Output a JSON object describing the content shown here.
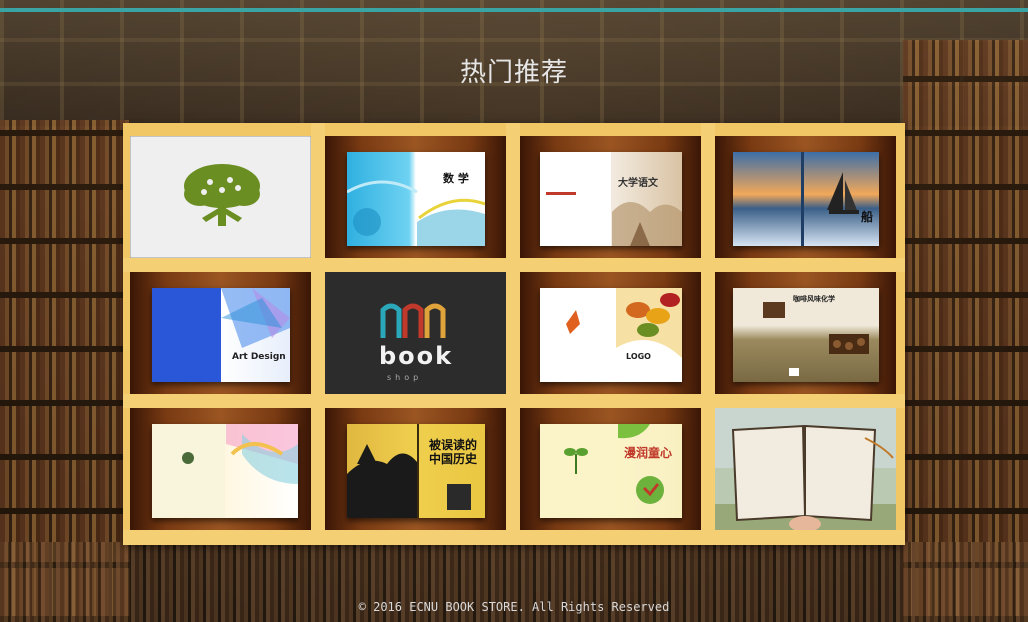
{
  "header": {
    "title": "热门推荐"
  },
  "footer": {
    "copyright": "© 2016 ECNU BOOK STORE. All Rights Reserved"
  },
  "books": [
    {
      "name": "book-tree-logo",
      "cover_text": ""
    },
    {
      "name": "book-math",
      "cover_text": "数 学"
    },
    {
      "name": "book-college-chinese",
      "cover_text": "大学语文"
    },
    {
      "name": "book-sea-boat",
      "cover_text": "船"
    },
    {
      "name": "book-logo-art-design",
      "cover_text": "Art Design"
    },
    {
      "name": "book-book-shop-logo",
      "cover_text": "book"
    },
    {
      "name": "book-autumn-leaves",
      "cover_text": "LOGO"
    },
    {
      "name": "book-coffee-culture",
      "cover_text": "咖啡风味化学"
    },
    {
      "name": "book-pastel-cover",
      "cover_text": ""
    },
    {
      "name": "book-misread-history",
      "cover_text": "被误读的中国历史"
    },
    {
      "name": "book-growth-heart",
      "cover_text": "漫润童心"
    },
    {
      "name": "book-open-notebook",
      "cover_text": ""
    }
  ]
}
